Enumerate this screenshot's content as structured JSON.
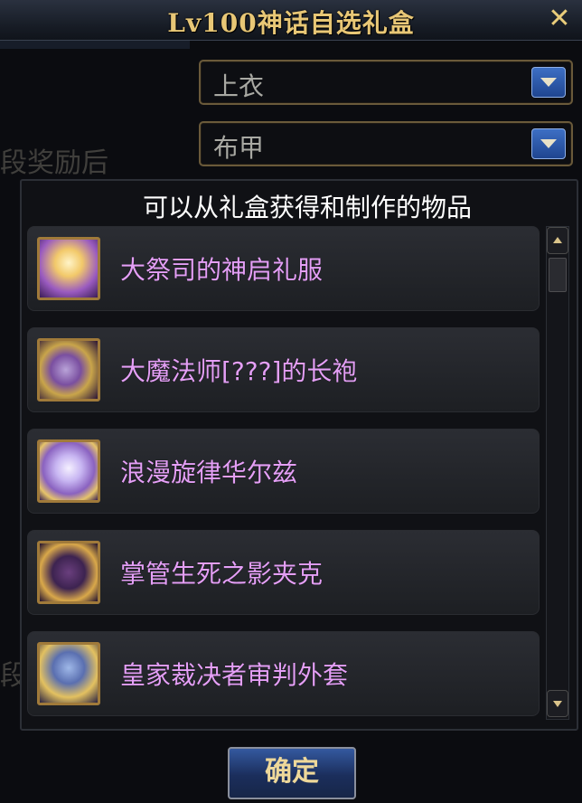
{
  "window": {
    "title": "Lv100神话自选礼盒",
    "close_glyph": "✕"
  },
  "background": {
    "fragment_1": "段奖励后",
    "fragment_2": "段"
  },
  "selects": [
    {
      "value": "上衣",
      "arrow_icon": "chevron-down-icon"
    },
    {
      "value": "布甲",
      "arrow_icon": "chevron-down-icon"
    }
  ],
  "panel": {
    "title": "可以从礼盒获得和制作的物品",
    "items": [
      {
        "name": "大祭司的神启礼服"
      },
      {
        "name": "大魔法师[???]的长袍"
      },
      {
        "name": "浪漫旋律华尔兹"
      },
      {
        "name": "掌管生死之影夹克"
      },
      {
        "name": "皇家裁决者审判外套"
      }
    ]
  },
  "confirm_label": "确定",
  "colors": {
    "title_gold": "#e8c776",
    "item_name_purple": "#e49ff6",
    "item_frame_gold": "#a07a3a",
    "select_arrow_blue": "#2f5fb5",
    "confirm_blue": "#2a4a8a"
  }
}
